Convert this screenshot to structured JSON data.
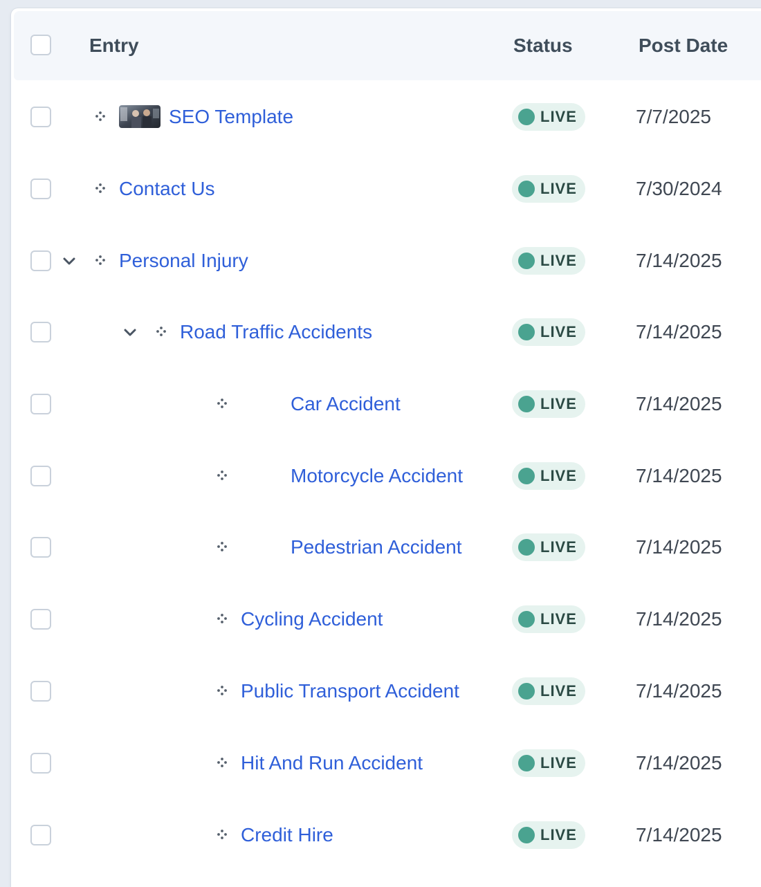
{
  "table": {
    "columns": {
      "entry": "Entry",
      "status": "Status",
      "post_date": "Post Date"
    },
    "rows": [
      {
        "title": "SEO Template",
        "status": "LIVE",
        "post_date": "7/7/2025",
        "has_thumbnail": true,
        "expanded": null
      },
      {
        "title": "Contact Us",
        "status": "LIVE",
        "post_date": "7/30/2024",
        "has_thumbnail": false,
        "expanded": null
      },
      {
        "title": "Personal Injury",
        "status": "LIVE",
        "post_date": "7/14/2025",
        "has_thumbnail": false,
        "expanded": true
      },
      {
        "title": "Road Traffic Accidents",
        "status": "LIVE",
        "post_date": "7/14/2025",
        "has_thumbnail": false,
        "expanded": true
      },
      {
        "title": "Car Accident",
        "status": "LIVE",
        "post_date": "7/14/2025",
        "has_thumbnail": false,
        "expanded": null
      },
      {
        "title": "Motorcycle Accident",
        "status": "LIVE",
        "post_date": "7/14/2025",
        "has_thumbnail": false,
        "expanded": null
      },
      {
        "title": "Pedestrian Accident",
        "status": "LIVE",
        "post_date": "7/14/2025",
        "has_thumbnail": false,
        "expanded": null
      },
      {
        "title": "Cycling Accident",
        "status": "LIVE",
        "post_date": "7/14/2025",
        "has_thumbnail": false,
        "expanded": null
      },
      {
        "title": "Public Transport Accident",
        "status": "LIVE",
        "post_date": "7/14/2025",
        "has_thumbnail": false,
        "expanded": null
      },
      {
        "title": "Hit And Run Accident",
        "status": "LIVE",
        "post_date": "7/14/2025",
        "has_thumbnail": false,
        "expanded": null
      },
      {
        "title": "Credit Hire",
        "status": "LIVE",
        "post_date": "7/14/2025",
        "has_thumbnail": false,
        "expanded": null
      }
    ]
  },
  "icons": {
    "row_expand": "chevron-down-icon",
    "row_drag": "move-handle-icon",
    "status_indicator": "status-dot-icon"
  },
  "colors": {
    "link": "#2f5fd9",
    "live_dot": "#4aa390",
    "live_badge_bg": "#e6f3ef",
    "header_bg": "#f4f7fb"
  }
}
